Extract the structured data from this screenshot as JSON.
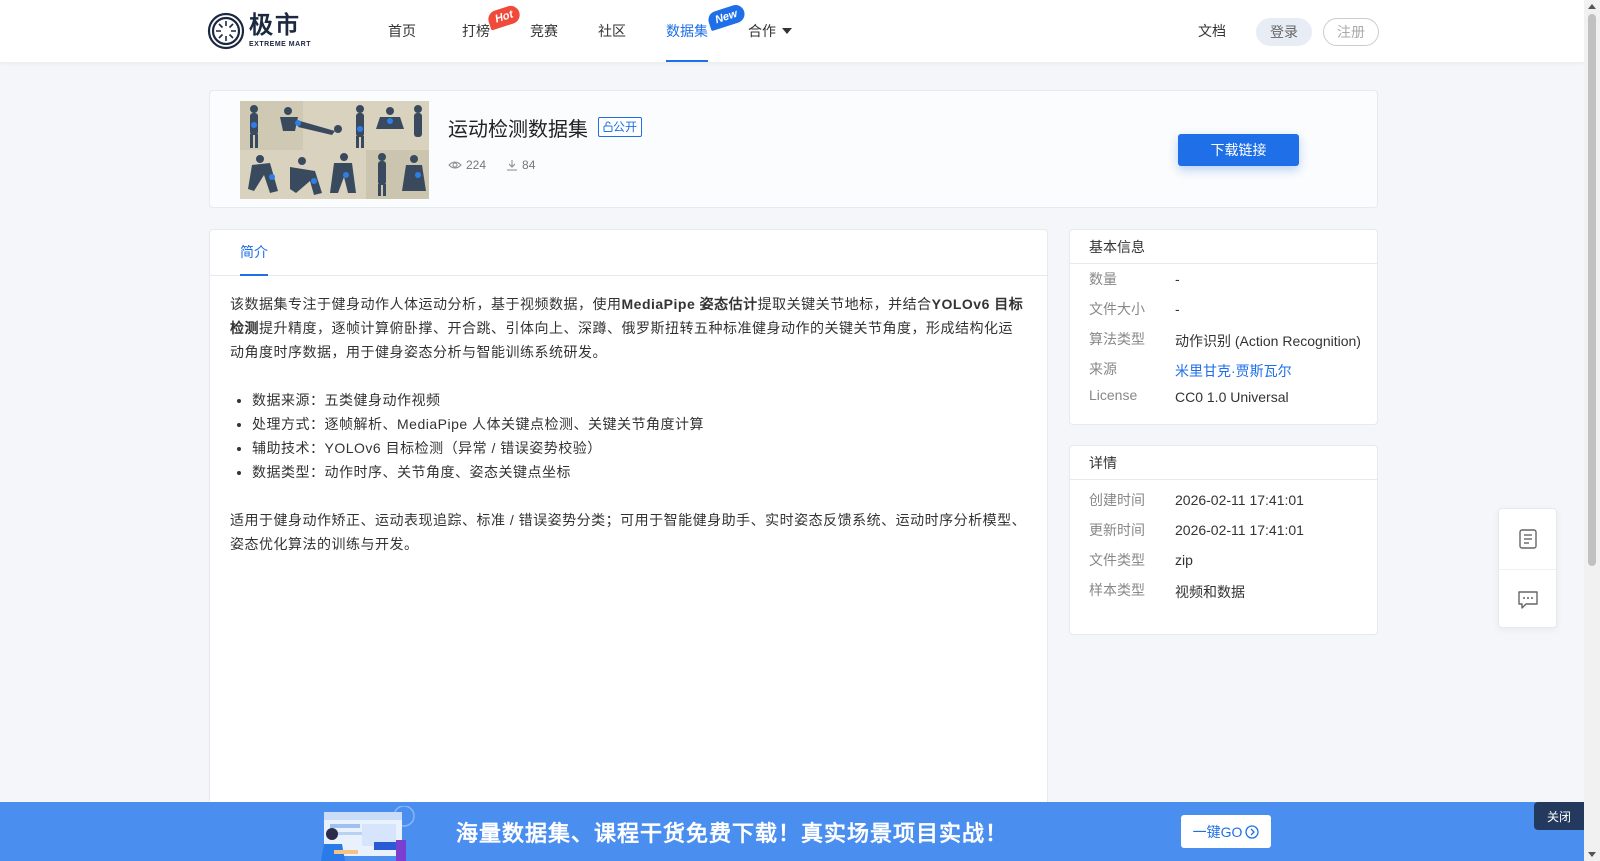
{
  "logo": {
    "cn": "极市",
    "en": "EXTREME MART"
  },
  "nav": {
    "items": [
      {
        "label": "首页"
      },
      {
        "label": "打榜",
        "badge": "Hot"
      },
      {
        "label": "竞赛"
      },
      {
        "label": "社区"
      },
      {
        "label": "数据集",
        "badge": "New"
      },
      {
        "label": "合作"
      }
    ],
    "active": "数据集",
    "docs": "文档",
    "login": "登录",
    "register": "注册"
  },
  "dataset": {
    "title": "运动检测数据集",
    "visibility": "公开",
    "views": "224",
    "downloads": "84",
    "download_button": "下载链接"
  },
  "intro": {
    "tab": "简介",
    "para1_parts": [
      {
        "text": "该数据集专注于健身动作人体运动分析，基于视频数据，使用",
        "bold": false
      },
      {
        "text": "MediaPipe 姿态估计",
        "bold": true
      },
      {
        "text": "提取关键关节地标，并结合",
        "bold": false
      },
      {
        "text": "YOLOv6 目标检测",
        "bold": true
      },
      {
        "text": "提升精度，逐帧计算俯卧撑、开合跳、引体向上、深蹲、俄罗斯扭转五种标准健身动作的关键关节角度，形成结构化运动角度时序数据，用于健身姿态分析与智能训练系统研发。",
        "bold": false
      }
    ],
    "bullets": [
      "数据来源：五类健身动作视频",
      "处理方式：逐帧解析、MediaPipe 人体关键点检测、关键关节角度计算",
      "辅助技术：YOLOv6 目标检测（异常 / 错误姿势校验）",
      "数据类型：动作时序、关节角度、姿态关键点坐标"
    ],
    "para2": "适用于健身动作矫正、运动表现追踪、标准 / 错误姿势分类；可用于智能健身助手、实时姿态反馈系统、运动时序分析模型、姿态优化算法的训练与开发。"
  },
  "basic_info": {
    "title": "基本信息",
    "rows": [
      {
        "key": "数量",
        "value": "-"
      },
      {
        "key": "文件大小",
        "value": "-"
      },
      {
        "key": "算法类型",
        "value": "动作识别 (Action Recognition)"
      },
      {
        "key": "来源",
        "value": "米里甘克·贾斯瓦尔",
        "link": true
      },
      {
        "key": "License",
        "value": "CC0 1.0 Universal"
      }
    ]
  },
  "details": {
    "title": "详情",
    "rows": [
      {
        "key": "创建时间",
        "value": "2026-02-11 17:41:01"
      },
      {
        "key": "更新时间",
        "value": "2026-02-11 17:41:01"
      },
      {
        "key": "文件类型",
        "value": "zip"
      },
      {
        "key": "样本类型",
        "value": "视频和数据"
      }
    ]
  },
  "banner": {
    "text": "海量数据集、课程干货免费下载！真实场景项目实战！",
    "go_button": "一键GO",
    "close": "关闭"
  },
  "colors": {
    "accent": "#1e6fe8",
    "hot_badge": "#f04a3a",
    "banner": "#4a8ef0",
    "close_button": "#23395d"
  },
  "icons": [
    "eye-icon",
    "download-icon",
    "caret-down-icon",
    "doc-icon",
    "chat-icon",
    "arrow-circle-icon",
    "lock-icon"
  ]
}
